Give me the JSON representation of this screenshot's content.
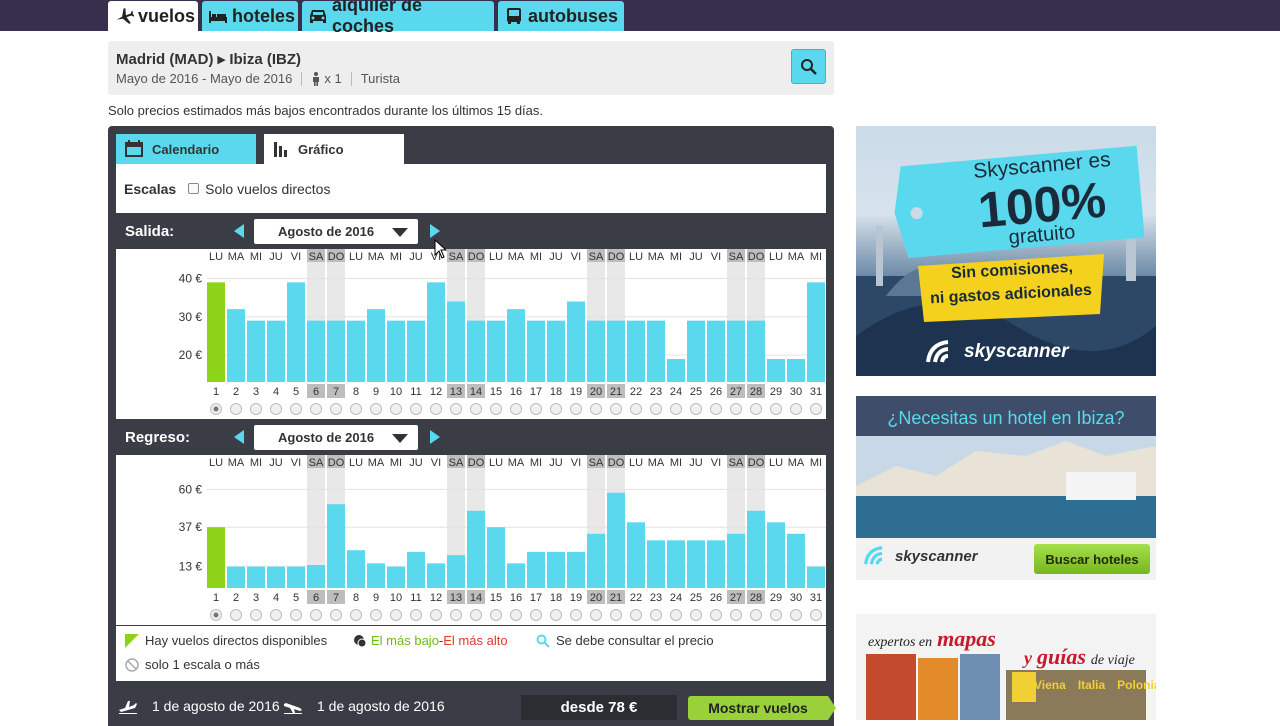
{
  "nav": {
    "tabs": [
      {
        "label": "vuelos",
        "icon": "plane-icon",
        "active": true
      },
      {
        "label": "hoteles",
        "icon": "bed-icon",
        "active": false
      },
      {
        "label": "alquiler de coches",
        "icon": "car-icon",
        "active": false
      },
      {
        "label": "autobuses",
        "icon": "bus-icon",
        "active": false
      }
    ]
  },
  "search": {
    "route": "Madrid (MAD) ▸ Ibiza (IBZ)",
    "dates": "Mayo de 2016 - Mayo de 2016",
    "passengers": "x 1",
    "cabin": "Turista"
  },
  "note": "Solo precios estimados más bajos encontrados durante los últimos 15 días.",
  "view_tabs": {
    "calendar": "Calendario",
    "chart": "Gráfico"
  },
  "filter": {
    "label": "Escalas",
    "direct_only": "Solo vuelos directos"
  },
  "salida": {
    "label": "Salida:",
    "month": "Agosto de 2016",
    "weekdays": [
      "LU",
      "MA",
      "MI",
      "JU",
      "VI",
      "SA",
      "DO",
      "LU",
      "MA",
      "MI",
      "JU",
      "VI",
      "SA",
      "DO",
      "LU",
      "MA",
      "MI",
      "JU",
      "VI",
      "SA",
      "DO",
      "LU",
      "MA",
      "MI",
      "JU",
      "VI",
      "SA",
      "DO",
      "LU",
      "MA",
      "MI"
    ],
    "days": [
      "1",
      "2",
      "3",
      "4",
      "5",
      "6",
      "7",
      "8",
      "9",
      "10",
      "11",
      "12",
      "13",
      "14",
      "15",
      "16",
      "17",
      "18",
      "19",
      "20",
      "21",
      "22",
      "23",
      "24",
      "25",
      "26",
      "27",
      "28",
      "29",
      "30",
      "31"
    ],
    "y_ticks": [
      "40 €",
      "30 €",
      "20 €"
    ]
  },
  "regreso": {
    "label": "Regreso:",
    "month": "Agosto de 2016",
    "weekdays": [
      "LU",
      "MA",
      "MI",
      "JU",
      "VI",
      "SA",
      "DO",
      "LU",
      "MA",
      "MI",
      "JU",
      "VI",
      "SA",
      "DO",
      "LU",
      "MA",
      "MI",
      "JU",
      "VI",
      "SA",
      "DO",
      "LU",
      "MA",
      "MI",
      "JU",
      "VI",
      "SA",
      "DO",
      "LU",
      "MA",
      "MI"
    ],
    "days": [
      "1",
      "2",
      "3",
      "4",
      "5",
      "6",
      "7",
      "8",
      "9",
      "10",
      "11",
      "12",
      "13",
      "14",
      "15",
      "16",
      "17",
      "18",
      "19",
      "20",
      "21",
      "22",
      "23",
      "24",
      "25",
      "26",
      "27",
      "28",
      "29",
      "30",
      "31"
    ],
    "y_ticks": [
      "60 €",
      "37 €",
      "13 €"
    ]
  },
  "chart_data": [
    {
      "type": "bar",
      "categories": [
        "1",
        "2",
        "3",
        "4",
        "5",
        "6",
        "7",
        "8",
        "9",
        "10",
        "11",
        "12",
        "13",
        "14",
        "15",
        "16",
        "17",
        "18",
        "19",
        "20",
        "21",
        "22",
        "23",
        "24",
        "25",
        "26",
        "27",
        "28",
        "29",
        "30",
        "31"
      ],
      "values": [
        39,
        32,
        29,
        29,
        39,
        29,
        29,
        29,
        32,
        29,
        29,
        39,
        34,
        29,
        29,
        32,
        29,
        29,
        34,
        29,
        29,
        29,
        29,
        19,
        29,
        29,
        29,
        29,
        19,
        19,
        39
      ],
      "ylim": [
        13,
        43
      ],
      "highlight": [
        1
      ],
      "selected": 1
    },
    {
      "type": "bar",
      "categories": [
        "1",
        "2",
        "3",
        "4",
        "5",
        "6",
        "7",
        "8",
        "9",
        "10",
        "11",
        "12",
        "13",
        "14",
        "15",
        "16",
        "17",
        "18",
        "19",
        "20",
        "21",
        "22",
        "23",
        "24",
        "25",
        "26",
        "27",
        "28",
        "29",
        "30",
        "31"
      ],
      "values": [
        37,
        13,
        13,
        13,
        13,
        14,
        51,
        23,
        15,
        13,
        22,
        15,
        20,
        47,
        37,
        15,
        22,
        22,
        22,
        33,
        58,
        40,
        29,
        29,
        29,
        29,
        33,
        47,
        40,
        33,
        13
      ],
      "ylim": [
        0,
        70
      ],
      "highlight": [
        1
      ],
      "selected": 1
    }
  ],
  "legend": {
    "direct": "Hay vuelos directos disponibles",
    "lowest": "El más bajo",
    "dash": "-",
    "highest": "El más alto",
    "consult": "Se debe consultar el precio",
    "one_stop": "solo 1 escala o más"
  },
  "footer": {
    "outbound_date": "1 de agosto de 2016",
    "return_date": "1 de agosto de 2016",
    "price": "desde 78 €",
    "show_button": "Mostrar vuelos"
  },
  "ads": {
    "ad1_line1": "Skyscanner es",
    "ad1_big": "100%",
    "ad1_line2": "gratuito",
    "ad1_badge1": "Sin comisiones,",
    "ad1_badge2": "ni gastos adicionales",
    "ad1_brand": "skyscanner",
    "ad2_title": "¿Necesitas un hotel en Ibiza?",
    "ad2_brand": "skyscanner",
    "ad2_button": "Buscar hoteles",
    "ad3_pre": "expertos en",
    "ad3_mid": "mapas",
    "ad3_y": "y",
    "ad3_guides": "guías",
    "ad3_post": "de viaje",
    "ad3_books": [
      "Viena",
      "Italia",
      "Polonia"
    ]
  },
  "colors": {
    "bar": "#5ad9ee",
    "highlight": "#8ed319",
    "weekend": "#bdbdbd",
    "nav_bg": "#382e4d",
    "panel": "#3a3d45"
  }
}
